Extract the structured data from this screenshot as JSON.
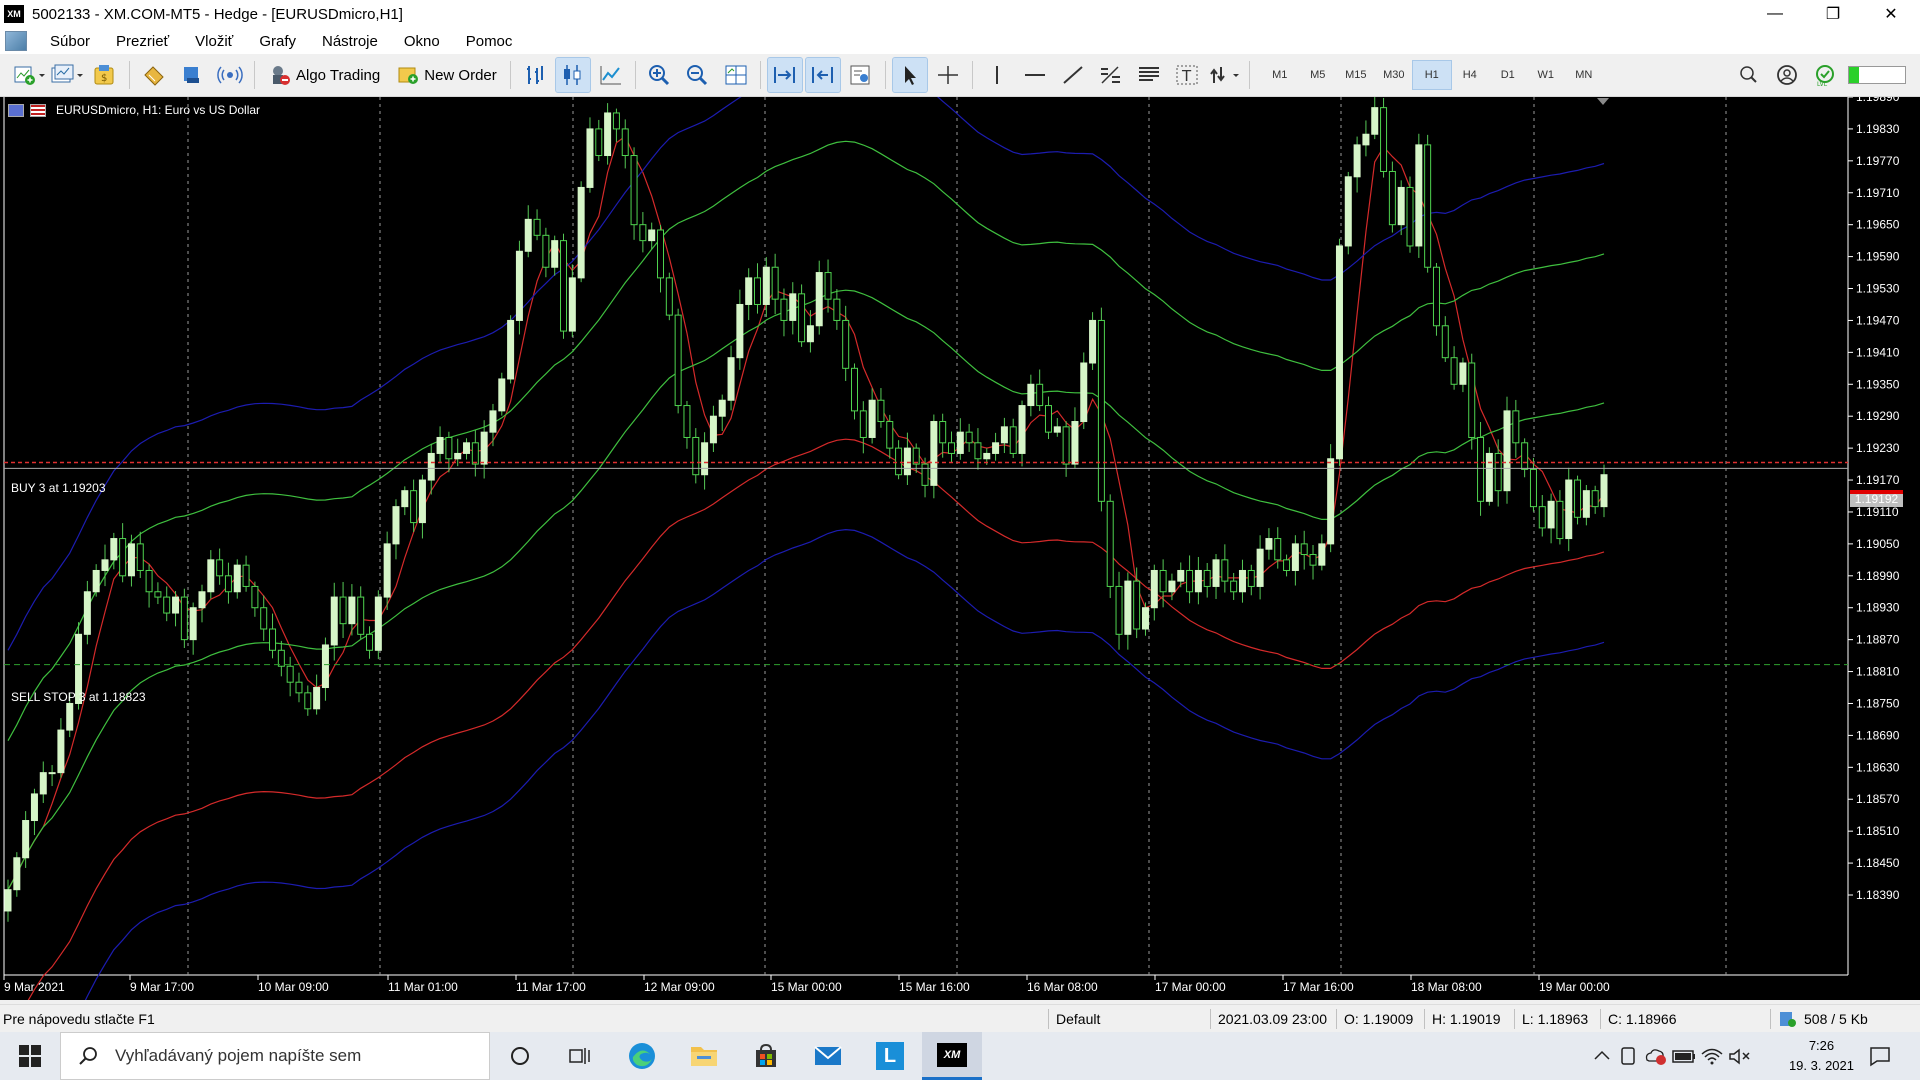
{
  "window": {
    "logo_text": "XM",
    "title": "5002133 - XM.COM-MT5 - Hedge - [EURUSDmicro,H1]",
    "minimize": "—",
    "maximize": "❐",
    "close": "✕"
  },
  "menu": {
    "items": [
      "Súbor",
      "Prezrieť",
      "Vložiť",
      "Grafy",
      "Nástroje",
      "Okno",
      "Pomoc"
    ],
    "mdi_minimize": "_",
    "mdi_restore": "❐",
    "mdi_close": "✕"
  },
  "toolbar": {
    "algo_trading": "Algo Trading",
    "new_order": "New Order",
    "timeframes": [
      "M1",
      "M5",
      "M15",
      "M30",
      "H1",
      "H4",
      "D1",
      "W1",
      "MN"
    ],
    "active_timeframe": "H1"
  },
  "chart": {
    "header": "EURUSDmicro, H1:  Euro vs US Dollar",
    "buy_label": "BUY 3 at 1.19203",
    "sell_label": "SELL STOP 3 at 1.18823",
    "current_price_label": "1.19192",
    "colors": {
      "background": "#000000",
      "bull_candle": "#d6f5c8",
      "bear_candle": "#2e9a2e",
      "red_line": "#d42a2a",
      "green_line": "#3fbf3f",
      "blue_line": "#1c1cb0",
      "axis_text": "#ffffff",
      "grid": "#9a9a9a"
    }
  },
  "chart_data": {
    "type": "candlestick",
    "symbol": "EURUSDmicro",
    "timeframe": "H1",
    "y_ticks": [
      "1.19890",
      "1.19830",
      "1.19770",
      "1.19710",
      "1.19650",
      "1.19590",
      "1.19530",
      "1.19470",
      "1.19410",
      "1.19350",
      "1.19290",
      "1.19230",
      "1.19170",
      "1.19110",
      "1.19050",
      "1.18990",
      "1.18930",
      "1.18870",
      "1.18810",
      "1.18750",
      "1.18690",
      "1.18630",
      "1.18570",
      "1.18510",
      "1.18450",
      "1.18390"
    ],
    "x_ticks": [
      "9 Mar 2021",
      "9 Mar 17:00",
      "10 Mar 09:00",
      "11 Mar 01:00",
      "11 Mar 17:00",
      "12 Mar 09:00",
      "15 Mar 00:00",
      "15 Mar 16:00",
      "16 Mar 08:00",
      "17 Mar 00:00",
      "17 Mar 16:00",
      "18 Mar 08:00",
      "19 Mar 00:00"
    ],
    "ylim": [
      1.18365,
      1.1992
    ],
    "buy_level": 1.19203,
    "sell_stop_level": 1.18823,
    "current_price": 1.19192,
    "closes": [
      1.184,
      1.1846,
      1.1853,
      1.1858,
      1.1862,
      1.1862,
      1.187,
      1.1875,
      1.1888,
      1.1896,
      1.19,
      1.1902,
      1.1906,
      1.1899,
      1.1905,
      1.19,
      1.1896,
      1.1895,
      1.1892,
      1.1895,
      1.1887,
      1.1893,
      1.1896,
      1.1902,
      1.1899,
      1.1896,
      1.1901,
      1.1897,
      1.1893,
      1.1889,
      1.1885,
      1.1882,
      1.1879,
      1.1877,
      1.1874,
      1.1878,
      1.1886,
      1.1895,
      1.189,
      1.1895,
      1.1888,
      1.1885,
      1.1895,
      1.1905,
      1.1912,
      1.1915,
      1.1909,
      1.1917,
      1.1922,
      1.1925,
      1.1921,
      1.1922,
      1.1924,
      1.192,
      1.1926,
      1.193,
      1.1936,
      1.1947,
      1.196,
      1.1966,
      1.1963,
      1.1957,
      1.1962,
      1.1945,
      1.1955,
      1.1972,
      1.1983,
      1.1978,
      1.1986,
      1.1983,
      1.1978,
      1.1965,
      1.1962,
      1.1964,
      1.1955,
      1.1948,
      1.1931,
      1.1925,
      1.1918,
      1.1924,
      1.1929,
      1.1932,
      1.194,
      1.195,
      1.1955,
      1.195,
      1.1957,
      1.1951,
      1.1947,
      1.1952,
      1.1943,
      1.1946,
      1.1956,
      1.1951,
      1.1947,
      1.1938,
      1.193,
      1.1925,
      1.1932,
      1.1928,
      1.1923,
      1.1918,
      1.1923,
      1.192,
      1.1916,
      1.1928,
      1.1924,
      1.1922,
      1.1926,
      1.1924,
      1.1921,
      1.1922,
      1.1924,
      1.1927,
      1.1922,
      1.1931,
      1.1935,
      1.1931,
      1.1926,
      1.1927,
      1.192,
      1.1928,
      1.1939,
      1.1947,
      1.1913,
      1.1897,
      1.1888,
      1.1898,
      1.1889,
      1.1893,
      1.19,
      1.1896,
      1.1898,
      1.19,
      1.1896,
      1.19,
      1.1897,
      1.1902,
      1.1898,
      1.1896,
      1.19,
      1.1897,
      1.1904,
      1.1906,
      1.1902,
      1.19,
      1.1905,
      1.1903,
      1.1901,
      1.1905,
      1.1921,
      1.1961,
      1.1974,
      1.198,
      1.1982,
      1.1987,
      1.1975,
      1.1965,
      1.1972,
      1.1961,
      1.198,
      1.1957,
      1.1946,
      1.194,
      1.1935,
      1.1939,
      1.1925,
      1.1913,
      1.1922,
      1.1915,
      1.193,
      1.1924,
      1.1919,
      1.1912,
      1.1908,
      1.1913,
      1.1906,
      1.1917,
      1.191,
      1.1915,
      1.1912,
      1.1918
    ]
  },
  "status": {
    "help": "Pre nápovedu stlačte F1",
    "profile": "Default",
    "datetime": "2021.03.09 23:00",
    "open": "O: 1.19009",
    "high": "H: 1.19019",
    "low": "L: 1.18963",
    "close": "C: 1.18966",
    "traffic": "508 / 5 Kb"
  },
  "taskbar": {
    "search_placeholder": "Vyhľadávaný pojem napíšte sem",
    "time": "7:26",
    "date": "19. 3. 2021",
    "xm_label": "XM",
    "l_label": "L"
  }
}
